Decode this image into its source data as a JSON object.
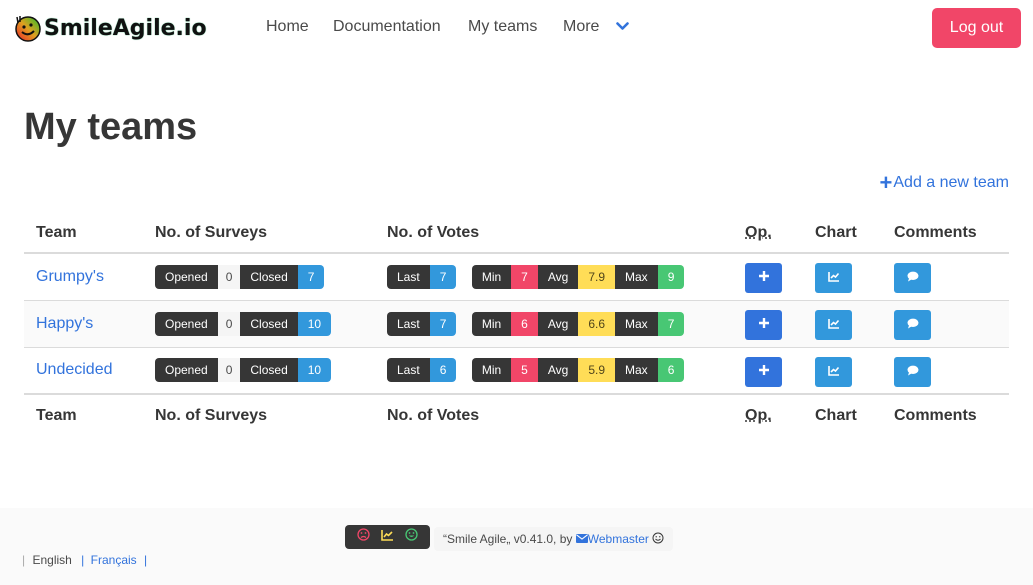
{
  "navbar": {
    "brand": "SmileAgile.io",
    "items": [
      {
        "label": "Home"
      },
      {
        "label": "Documentation"
      },
      {
        "label": "My teams"
      },
      {
        "label": "More"
      }
    ],
    "logout_label": "Log out"
  },
  "page": {
    "title": "My teams",
    "add_team_label": "Add a new team"
  },
  "table": {
    "headers": {
      "team": "Team",
      "surveys": "No. of Surveys",
      "votes": "No. of Votes",
      "op": "Op.",
      "chart": "Chart",
      "comments": "Comments"
    },
    "labels": {
      "opened": "Opened",
      "closed": "Closed",
      "last": "Last",
      "min": "Min",
      "avg": "Avg",
      "max": "Max"
    },
    "rows": [
      {
        "team": "Grumpy's",
        "opened": "0",
        "closed": "7",
        "last": "7",
        "min": "7",
        "avg": "7.9",
        "max": "9"
      },
      {
        "team": "Happy's",
        "opened": "0",
        "closed": "10",
        "last": "7",
        "min": "6",
        "avg": "6.6",
        "max": "7"
      },
      {
        "team": "Undecided",
        "opened": "0",
        "closed": "10",
        "last": "6",
        "min": "5",
        "avg": "5.9",
        "max": "6"
      }
    ]
  },
  "footer": {
    "credit_prefix": "“Smile Agile„ v0.41.0, by",
    "webmaster": "Webmaster",
    "languages": {
      "english": "English",
      "french": "Français"
    }
  },
  "colors": {
    "primary_link": "#3273dc",
    "danger": "#f14668",
    "info": "#3298dc",
    "warning": "#ffdd57",
    "success": "#48c774",
    "dark": "#363636"
  }
}
